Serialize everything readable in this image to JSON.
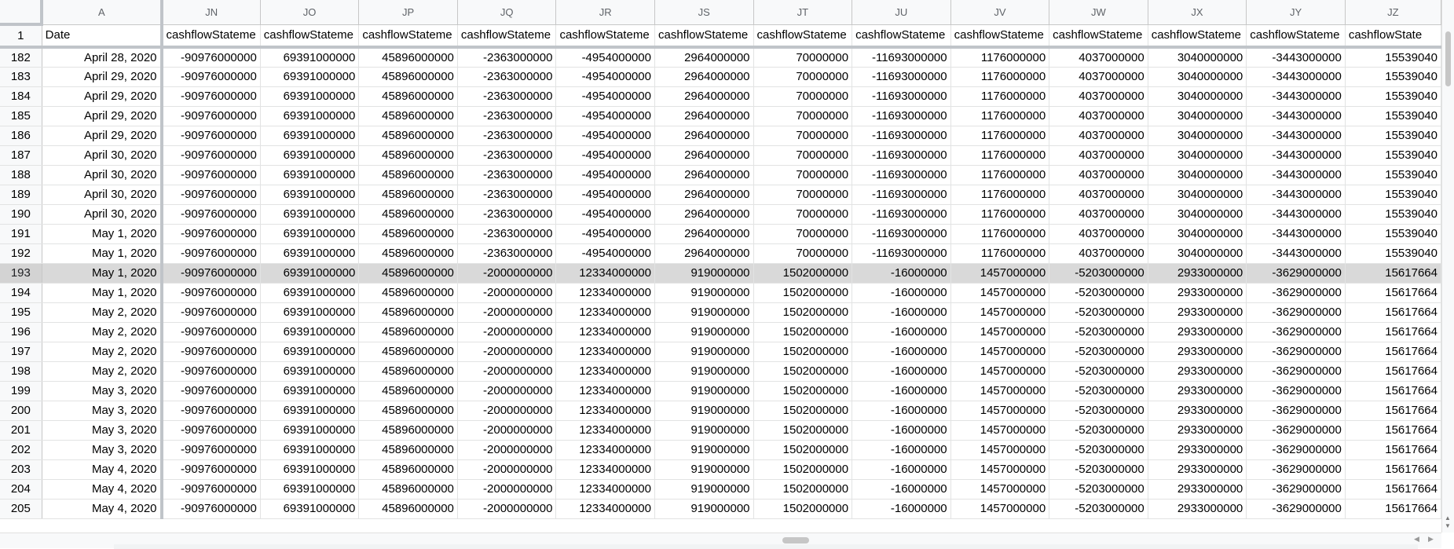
{
  "sheet": {
    "col_a_letter": "A",
    "columns": [
      "JN",
      "JO",
      "JP",
      "JQ",
      "JR",
      "JS",
      "JT",
      "JU",
      "JV",
      "JW",
      "JX",
      "JY",
      "JZ"
    ],
    "frozen_row": {
      "num": "1",
      "col_a": "Date",
      "headers": [
        "cashflowStateme",
        "cashflowStateme",
        "cashflowStateme",
        "cashflowStateme",
        "cashflowStateme",
        "cashflowStateme",
        "cashflowStateme",
        "cashflowStateme",
        "cashflowStateme",
        "cashflowStateme",
        "cashflowStateme",
        "cashflowStateme",
        "cashflowState"
      ]
    },
    "selected_row": "193",
    "rows": [
      {
        "num": "182",
        "date": "April 28, 2020",
        "values": [
          "-90976000000",
          "69391000000",
          "45896000000",
          "-2363000000",
          "-4954000000",
          "2964000000",
          "70000000",
          "-11693000000",
          "1176000000",
          "4037000000",
          "3040000000",
          "-3443000000",
          "15539040"
        ]
      },
      {
        "num": "183",
        "date": "April 29, 2020",
        "values": [
          "-90976000000",
          "69391000000",
          "45896000000",
          "-2363000000",
          "-4954000000",
          "2964000000",
          "70000000",
          "-11693000000",
          "1176000000",
          "4037000000",
          "3040000000",
          "-3443000000",
          "15539040"
        ]
      },
      {
        "num": "184",
        "date": "April 29, 2020",
        "values": [
          "-90976000000",
          "69391000000",
          "45896000000",
          "-2363000000",
          "-4954000000",
          "2964000000",
          "70000000",
          "-11693000000",
          "1176000000",
          "4037000000",
          "3040000000",
          "-3443000000",
          "15539040"
        ]
      },
      {
        "num": "185",
        "date": "April 29, 2020",
        "values": [
          "-90976000000",
          "69391000000",
          "45896000000",
          "-2363000000",
          "-4954000000",
          "2964000000",
          "70000000",
          "-11693000000",
          "1176000000",
          "4037000000",
          "3040000000",
          "-3443000000",
          "15539040"
        ]
      },
      {
        "num": "186",
        "date": "April 29, 2020",
        "values": [
          "-90976000000",
          "69391000000",
          "45896000000",
          "-2363000000",
          "-4954000000",
          "2964000000",
          "70000000",
          "-11693000000",
          "1176000000",
          "4037000000",
          "3040000000",
          "-3443000000",
          "15539040"
        ]
      },
      {
        "num": "187",
        "date": "April 30, 2020",
        "values": [
          "-90976000000",
          "69391000000",
          "45896000000",
          "-2363000000",
          "-4954000000",
          "2964000000",
          "70000000",
          "-11693000000",
          "1176000000",
          "4037000000",
          "3040000000",
          "-3443000000",
          "15539040"
        ]
      },
      {
        "num": "188",
        "date": "April 30, 2020",
        "values": [
          "-90976000000",
          "69391000000",
          "45896000000",
          "-2363000000",
          "-4954000000",
          "2964000000",
          "70000000",
          "-11693000000",
          "1176000000",
          "4037000000",
          "3040000000",
          "-3443000000",
          "15539040"
        ]
      },
      {
        "num": "189",
        "date": "April 30, 2020",
        "values": [
          "-90976000000",
          "69391000000",
          "45896000000",
          "-2363000000",
          "-4954000000",
          "2964000000",
          "70000000",
          "-11693000000",
          "1176000000",
          "4037000000",
          "3040000000",
          "-3443000000",
          "15539040"
        ]
      },
      {
        "num": "190",
        "date": "April 30, 2020",
        "values": [
          "-90976000000",
          "69391000000",
          "45896000000",
          "-2363000000",
          "-4954000000",
          "2964000000",
          "70000000",
          "-11693000000",
          "1176000000",
          "4037000000",
          "3040000000",
          "-3443000000",
          "15539040"
        ]
      },
      {
        "num": "191",
        "date": "May 1, 2020",
        "values": [
          "-90976000000",
          "69391000000",
          "45896000000",
          "-2363000000",
          "-4954000000",
          "2964000000",
          "70000000",
          "-11693000000",
          "1176000000",
          "4037000000",
          "3040000000",
          "-3443000000",
          "15539040"
        ]
      },
      {
        "num": "192",
        "date": "May 1, 2020",
        "values": [
          "-90976000000",
          "69391000000",
          "45896000000",
          "-2363000000",
          "-4954000000",
          "2964000000",
          "70000000",
          "-11693000000",
          "1176000000",
          "4037000000",
          "3040000000",
          "-3443000000",
          "15539040"
        ]
      },
      {
        "num": "193",
        "date": "May 1, 2020",
        "values": [
          "-90976000000",
          "69391000000",
          "45896000000",
          "-2000000000",
          "12334000000",
          "919000000",
          "1502000000",
          "-16000000",
          "1457000000",
          "-5203000000",
          "2933000000",
          "-3629000000",
          "15617664"
        ]
      },
      {
        "num": "194",
        "date": "May 1, 2020",
        "values": [
          "-90976000000",
          "69391000000",
          "45896000000",
          "-2000000000",
          "12334000000",
          "919000000",
          "1502000000",
          "-16000000",
          "1457000000",
          "-5203000000",
          "2933000000",
          "-3629000000",
          "15617664"
        ]
      },
      {
        "num": "195",
        "date": "May 2, 2020",
        "values": [
          "-90976000000",
          "69391000000",
          "45896000000",
          "-2000000000",
          "12334000000",
          "919000000",
          "1502000000",
          "-16000000",
          "1457000000",
          "-5203000000",
          "2933000000",
          "-3629000000",
          "15617664"
        ]
      },
      {
        "num": "196",
        "date": "May 2, 2020",
        "values": [
          "-90976000000",
          "69391000000",
          "45896000000",
          "-2000000000",
          "12334000000",
          "919000000",
          "1502000000",
          "-16000000",
          "1457000000",
          "-5203000000",
          "2933000000",
          "-3629000000",
          "15617664"
        ]
      },
      {
        "num": "197",
        "date": "May 2, 2020",
        "values": [
          "-90976000000",
          "69391000000",
          "45896000000",
          "-2000000000",
          "12334000000",
          "919000000",
          "1502000000",
          "-16000000",
          "1457000000",
          "-5203000000",
          "2933000000",
          "-3629000000",
          "15617664"
        ]
      },
      {
        "num": "198",
        "date": "May 2, 2020",
        "values": [
          "-90976000000",
          "69391000000",
          "45896000000",
          "-2000000000",
          "12334000000",
          "919000000",
          "1502000000",
          "-16000000",
          "1457000000",
          "-5203000000",
          "2933000000",
          "-3629000000",
          "15617664"
        ]
      },
      {
        "num": "199",
        "date": "May 3, 2020",
        "values": [
          "-90976000000",
          "69391000000",
          "45896000000",
          "-2000000000",
          "12334000000",
          "919000000",
          "1502000000",
          "-16000000",
          "1457000000",
          "-5203000000",
          "2933000000",
          "-3629000000",
          "15617664"
        ]
      },
      {
        "num": "200",
        "date": "May 3, 2020",
        "values": [
          "-90976000000",
          "69391000000",
          "45896000000",
          "-2000000000",
          "12334000000",
          "919000000",
          "1502000000",
          "-16000000",
          "1457000000",
          "-5203000000",
          "2933000000",
          "-3629000000",
          "15617664"
        ]
      },
      {
        "num": "201",
        "date": "May 3, 2020",
        "values": [
          "-90976000000",
          "69391000000",
          "45896000000",
          "-2000000000",
          "12334000000",
          "919000000",
          "1502000000",
          "-16000000",
          "1457000000",
          "-5203000000",
          "2933000000",
          "-3629000000",
          "15617664"
        ]
      },
      {
        "num": "202",
        "date": "May 3, 2020",
        "values": [
          "-90976000000",
          "69391000000",
          "45896000000",
          "-2000000000",
          "12334000000",
          "919000000",
          "1502000000",
          "-16000000",
          "1457000000",
          "-5203000000",
          "2933000000",
          "-3629000000",
          "15617664"
        ]
      },
      {
        "num": "203",
        "date": "May 4, 2020",
        "values": [
          "-90976000000",
          "69391000000",
          "45896000000",
          "-2000000000",
          "12334000000",
          "919000000",
          "1502000000",
          "-16000000",
          "1457000000",
          "-5203000000",
          "2933000000",
          "-3629000000",
          "15617664"
        ]
      },
      {
        "num": "204",
        "date": "May 4, 2020",
        "values": [
          "-90976000000",
          "69391000000",
          "45896000000",
          "-2000000000",
          "12334000000",
          "919000000",
          "1502000000",
          "-16000000",
          "1457000000",
          "-5203000000",
          "2933000000",
          "-3629000000",
          "15617664"
        ]
      },
      {
        "num": "205",
        "date": "May 4, 2020",
        "values": [
          "-90976000000",
          "69391000000",
          "45896000000",
          "-2000000000",
          "12334000000",
          "919000000",
          "1502000000",
          "-16000000",
          "1457000000",
          "-5203000000",
          "2933000000",
          "-3629000000",
          "15617664"
        ]
      }
    ]
  },
  "colors": {
    "header_bg": "#f8f9fa",
    "grid_line": "#e2e3e3",
    "selected_row_bg": "#d9d9d9",
    "freeze_line": "#c0c4c9"
  },
  "scroll": {
    "up_arrow": "▲",
    "down_arrow": "▼",
    "left_arrow": "◀",
    "right_arrow": "▶"
  }
}
